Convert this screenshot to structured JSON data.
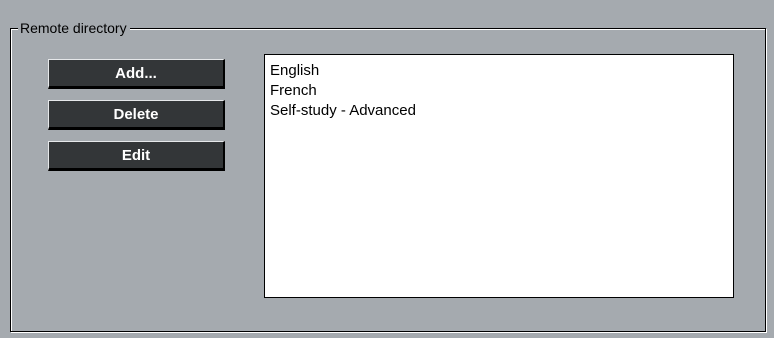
{
  "remote_directory": {
    "group_label": "Remote directory",
    "buttons": {
      "add_label": "Add...",
      "delete_label": "Delete",
      "edit_label": "Edit"
    },
    "items": [
      {
        "label": "English"
      },
      {
        "label": "French"
      },
      {
        "label": "Self-study - Advanced"
      }
    ]
  }
}
